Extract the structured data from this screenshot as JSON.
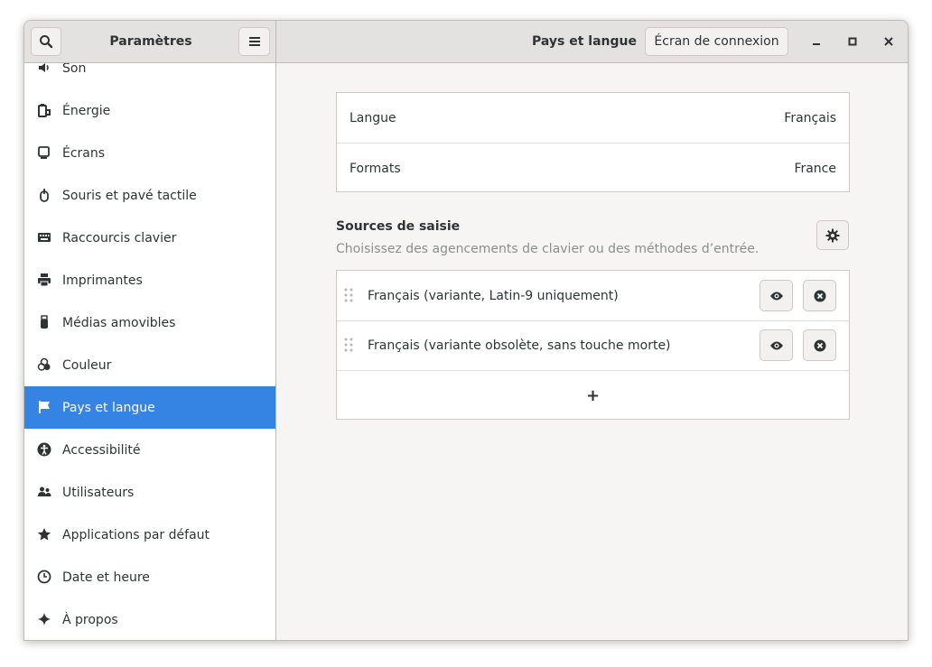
{
  "header": {
    "app_title": "Paramètres",
    "page_title": "Pays et langue",
    "login_screen_button": "Écran de connexion"
  },
  "sidebar": {
    "items": [
      {
        "label": "Son",
        "icon": "speaker-icon"
      },
      {
        "label": "Énergie",
        "icon": "battery-icon"
      },
      {
        "label": "Écrans",
        "icon": "display-icon"
      },
      {
        "label": "Souris et pavé tactile",
        "icon": "mouse-icon"
      },
      {
        "label": "Raccourcis clavier",
        "icon": "keyboard-icon"
      },
      {
        "label": "Imprimantes",
        "icon": "printer-icon"
      },
      {
        "label": "Médias amovibles",
        "icon": "usb-icon"
      },
      {
        "label": "Couleur",
        "icon": "color-icon"
      },
      {
        "label": "Pays et langue",
        "icon": "flag-icon",
        "selected": true
      },
      {
        "label": "Accessibilité",
        "icon": "accessibility-icon"
      },
      {
        "label": "Utilisateurs",
        "icon": "users-icon"
      },
      {
        "label": "Applications par défaut",
        "icon": "star-icon"
      },
      {
        "label": "Date et heure",
        "icon": "clock-icon"
      },
      {
        "label": "À propos",
        "icon": "sparkle-icon"
      }
    ]
  },
  "main": {
    "language_label": "Langue",
    "language_value": "Français",
    "formats_label": "Formats",
    "formats_value": "France",
    "input_sources": {
      "title": "Sources de saisie",
      "subtitle": "Choisissez des agencements de clavier ou des méthodes d’entrée.",
      "items": [
        {
          "label": "Français (variante, Latin-9 uniquement)"
        },
        {
          "label": "Français (variante obsolète, sans touche morte)"
        }
      ],
      "add_label": "+"
    }
  },
  "colors": {
    "accent": "#3584e4",
    "window_bg": "#f6f5f4",
    "header_bg": "#e4e2e0",
    "text": "#2e3436",
    "dim_text": "#8b8e8f"
  }
}
